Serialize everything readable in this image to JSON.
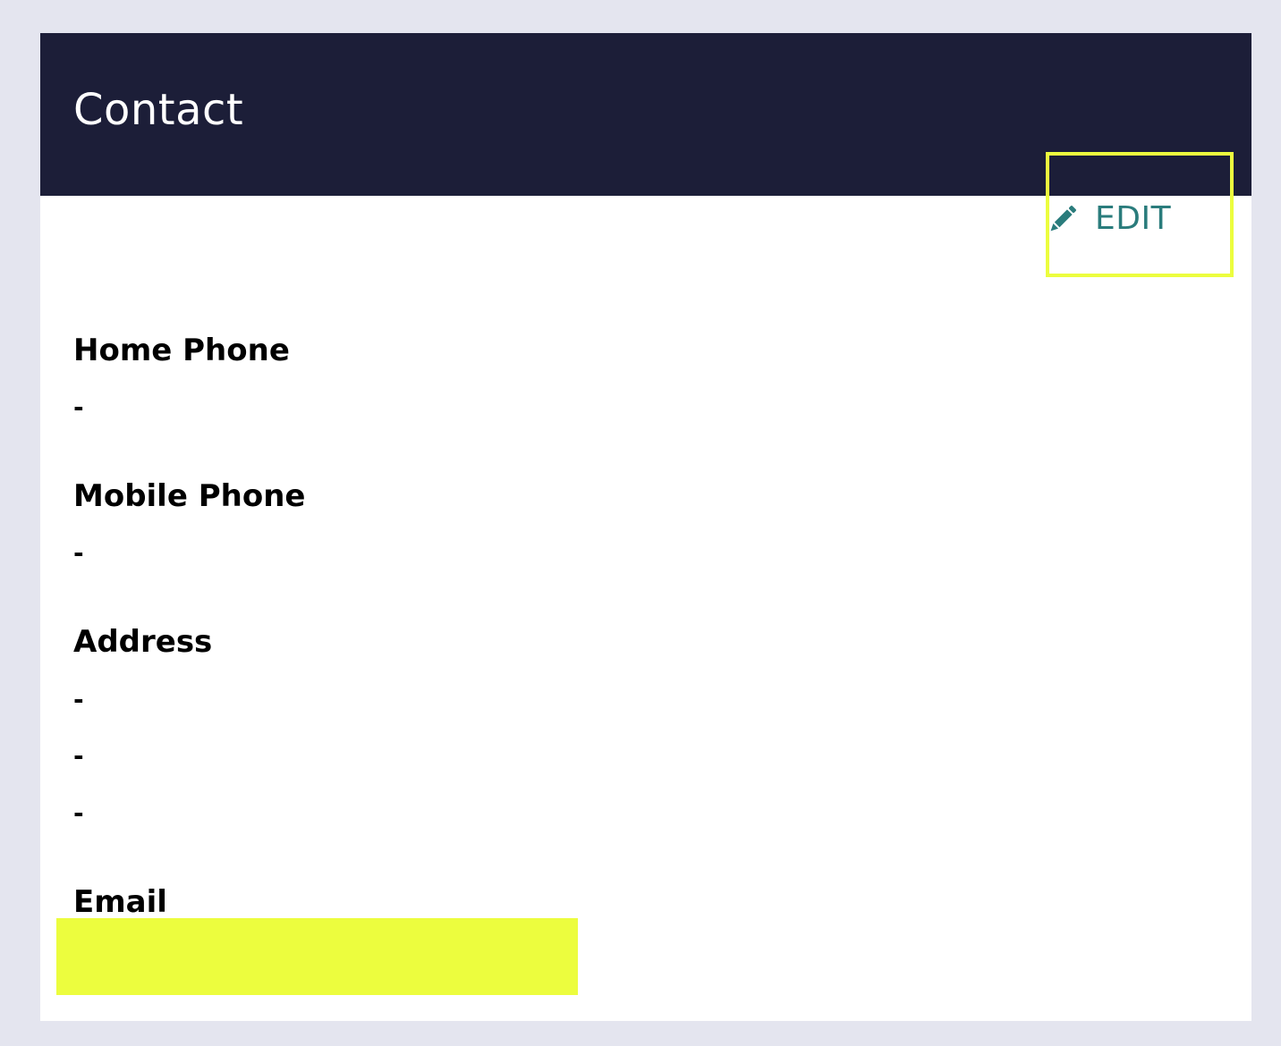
{
  "colors": {
    "page_background": "#e4e5ef",
    "header_background": "#1c1e38",
    "card_background": "#ffffff",
    "accent_teal": "#2a7c7c",
    "highlight_yellow": "#ecfd3e"
  },
  "card": {
    "title": "Contact"
  },
  "edit": {
    "label": "EDIT",
    "icon": "pencil-icon"
  },
  "fields": {
    "home_phone": {
      "label": "Home Phone",
      "value": "-"
    },
    "mobile_phone": {
      "label": "Mobile Phone",
      "value": "-"
    },
    "address": {
      "label": "Address",
      "lines": [
        "-",
        "-",
        "-"
      ]
    },
    "email": {
      "label": "Email"
    }
  }
}
